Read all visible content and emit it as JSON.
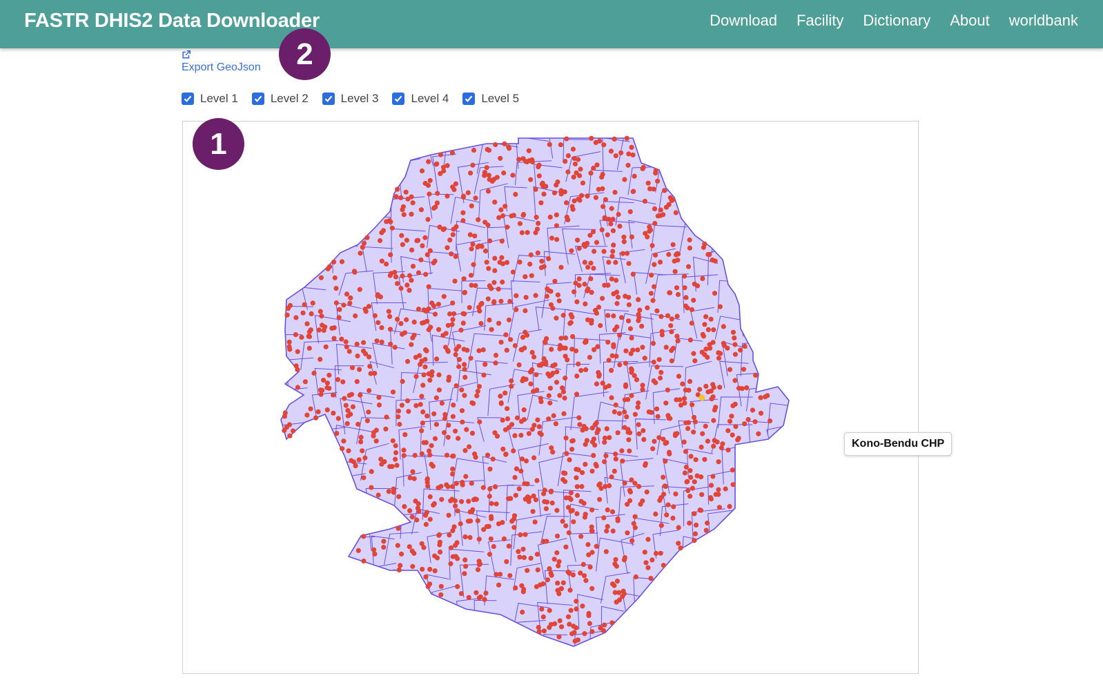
{
  "app": {
    "title": "FASTR DHIS2 Data Downloader"
  },
  "nav": {
    "items": [
      {
        "label": "Download"
      },
      {
        "label": "Facility"
      },
      {
        "label": "Dictionary"
      },
      {
        "label": "About"
      },
      {
        "label": "worldbank"
      }
    ]
  },
  "annotations": {
    "badge_one": "1",
    "badge_two": "2"
  },
  "export": {
    "label": "Export GeoJson",
    "icon": "external-link-icon"
  },
  "levels": [
    {
      "label": "Level 1",
      "checked": true
    },
    {
      "label": "Level 2",
      "checked": true
    },
    {
      "label": "Level 3",
      "checked": true
    },
    {
      "label": "Level 4",
      "checked": true
    },
    {
      "label": "Level 5",
      "checked": true
    }
  ],
  "map": {
    "tooltip": "Kono-Bendu CHP",
    "colors": {
      "region_fill": "#d9d3fb",
      "region_stroke": "#6b4ee0",
      "facility_point": "#e0453a",
      "highlight_point": "#f2c431"
    }
  },
  "colors": {
    "navbar": "#4e9f98",
    "badge": "#6b1f6b",
    "link": "#3a6fe0",
    "checkbox": "#2b6de0"
  }
}
